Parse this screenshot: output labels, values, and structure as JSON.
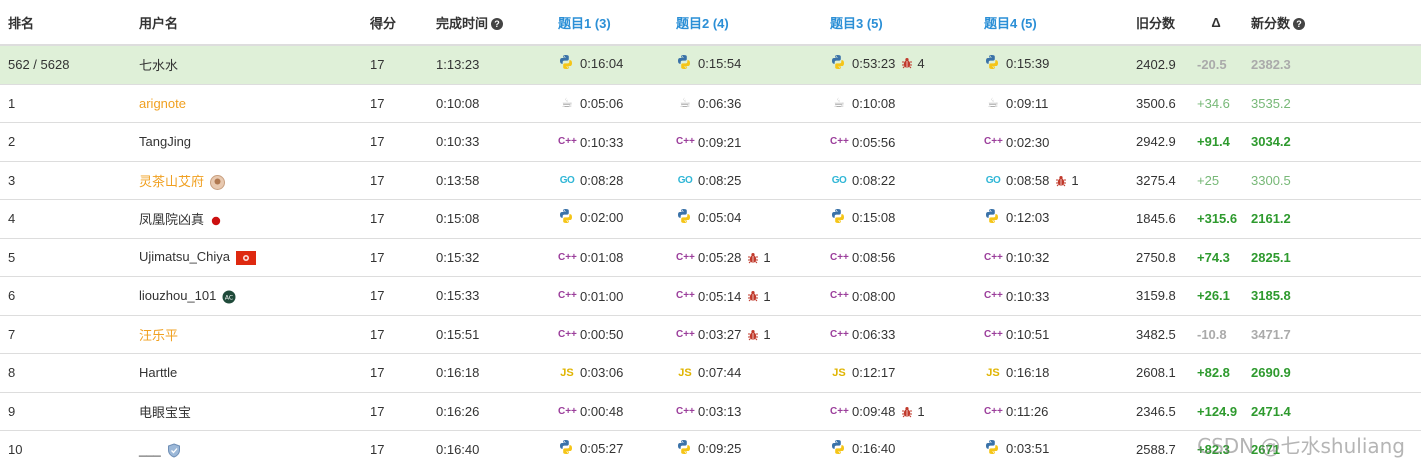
{
  "headers": {
    "rank": "排名",
    "user": "用户名",
    "score": "得分",
    "finish_time": "完成时间",
    "q1": "题目1 (3)",
    "q2": "题目2 (4)",
    "q3": "题目3 (5)",
    "q4": "题目4 (5)",
    "old_rating": "旧分数",
    "delta": "Δ",
    "new_rating": "新分数"
  },
  "rows": [
    {
      "rank": "562 / 5628",
      "user": "七水水",
      "user_style": "normal",
      "badge": "",
      "score": "17",
      "time": "1:13:23",
      "q": [
        {
          "lang": "python",
          "time": "0:16:04",
          "bugs": ""
        },
        {
          "lang": "python",
          "time": "0:15:54",
          "bugs": ""
        },
        {
          "lang": "python",
          "time": "0:53:23",
          "bugs": "4"
        },
        {
          "lang": "python",
          "time": "0:15:39",
          "bugs": ""
        }
      ],
      "old": "2402.9",
      "delta": "-20.5",
      "new": "2382.3",
      "sign": "neg",
      "self": true
    },
    {
      "rank": "1",
      "user": "arignote",
      "user_style": "orange",
      "badge": "",
      "score": "17",
      "time": "0:10:08",
      "q": [
        {
          "lang": "java",
          "time": "0:05:06",
          "bugs": ""
        },
        {
          "lang": "java",
          "time": "0:06:36",
          "bugs": ""
        },
        {
          "lang": "java",
          "time": "0:10:08",
          "bugs": ""
        },
        {
          "lang": "java",
          "time": "0:09:11",
          "bugs": ""
        }
      ],
      "old": "3500.6",
      "delta": "+34.6",
      "new": "3535.2",
      "sign": "light",
      "self": false
    },
    {
      "rank": "2",
      "user": "TangJing",
      "user_style": "normal",
      "badge": "",
      "score": "17",
      "time": "0:10:33",
      "q": [
        {
          "lang": "cpp",
          "time": "0:10:33",
          "bugs": ""
        },
        {
          "lang": "cpp",
          "time": "0:09:21",
          "bugs": ""
        },
        {
          "lang": "cpp",
          "time": "0:05:56",
          "bugs": ""
        },
        {
          "lang": "cpp",
          "time": "0:02:30",
          "bugs": ""
        }
      ],
      "old": "2942.9",
      "delta": "+91.4",
      "new": "3034.2",
      "sign": "pos",
      "self": false
    },
    {
      "rank": "3",
      "user": "灵茶山艾府",
      "user_style": "orange",
      "badge": "avatar",
      "score": "17",
      "time": "0:13:58",
      "q": [
        {
          "lang": "go",
          "time": "0:08:28",
          "bugs": ""
        },
        {
          "lang": "go",
          "time": "0:08:25",
          "bugs": ""
        },
        {
          "lang": "go",
          "time": "0:08:22",
          "bugs": ""
        },
        {
          "lang": "go",
          "time": "0:08:58",
          "bugs": "1"
        }
      ],
      "old": "3275.4",
      "delta": "+25",
      "new": "3300.5",
      "sign": "light",
      "self": false
    },
    {
      "rank": "4",
      "user": "凤凰院凶真",
      "user_style": "normal",
      "badge": "jp-flag",
      "score": "17",
      "time": "0:15:08",
      "q": [
        {
          "lang": "python",
          "time": "0:02:00",
          "bugs": ""
        },
        {
          "lang": "python",
          "time": "0:05:04",
          "bugs": ""
        },
        {
          "lang": "python",
          "time": "0:15:08",
          "bugs": ""
        },
        {
          "lang": "python",
          "time": "0:12:03",
          "bugs": ""
        }
      ],
      "old": "1845.6",
      "delta": "+315.6",
      "new": "2161.2",
      "sign": "pos",
      "self": false
    },
    {
      "rank": "5",
      "user": "Ujimatsu_Chiya",
      "user_style": "normal",
      "badge": "hk-flag",
      "score": "17",
      "time": "0:15:32",
      "q": [
        {
          "lang": "cpp",
          "time": "0:01:08",
          "bugs": ""
        },
        {
          "lang": "cpp",
          "time": "0:05:28",
          "bugs": "1"
        },
        {
          "lang": "cpp",
          "time": "0:08:56",
          "bugs": ""
        },
        {
          "lang": "cpp",
          "time": "0:10:32",
          "bugs": ""
        }
      ],
      "old": "2750.8",
      "delta": "+74.3",
      "new": "2825.1",
      "sign": "pos",
      "self": false
    },
    {
      "rank": "6",
      "user": "liouzhou_101",
      "user_style": "normal",
      "badge": "lc-badge",
      "score": "17",
      "time": "0:15:33",
      "q": [
        {
          "lang": "cpp",
          "time": "0:01:00",
          "bugs": ""
        },
        {
          "lang": "cpp",
          "time": "0:05:14",
          "bugs": "1"
        },
        {
          "lang": "cpp",
          "time": "0:08:00",
          "bugs": ""
        },
        {
          "lang": "cpp",
          "time": "0:10:33",
          "bugs": ""
        }
      ],
      "old": "3159.8",
      "delta": "+26.1",
      "new": "3185.8",
      "sign": "pos",
      "self": false
    },
    {
      "rank": "7",
      "user": "汪乐平",
      "user_style": "orange",
      "badge": "",
      "score": "17",
      "time": "0:15:51",
      "q": [
        {
          "lang": "cpp",
          "time": "0:00:50",
          "bugs": ""
        },
        {
          "lang": "cpp",
          "time": "0:03:27",
          "bugs": "1"
        },
        {
          "lang": "cpp",
          "time": "0:06:33",
          "bugs": ""
        },
        {
          "lang": "cpp",
          "time": "0:10:51",
          "bugs": ""
        }
      ],
      "old": "3482.5",
      "delta": "-10.8",
      "new": "3471.7",
      "sign": "neg",
      "self": false
    },
    {
      "rank": "8",
      "user": "Harttle",
      "user_style": "normal",
      "badge": "",
      "score": "17",
      "time": "0:16:18",
      "q": [
        {
          "lang": "js",
          "time": "0:03:06",
          "bugs": ""
        },
        {
          "lang": "js",
          "time": "0:07:44",
          "bugs": ""
        },
        {
          "lang": "js",
          "time": "0:12:17",
          "bugs": ""
        },
        {
          "lang": "js",
          "time": "0:16:18",
          "bugs": ""
        }
      ],
      "old": "2608.1",
      "delta": "+82.8",
      "new": "2690.9",
      "sign": "pos",
      "self": false
    },
    {
      "rank": "9",
      "user": "电眼宝宝",
      "user_style": "normal",
      "badge": "",
      "score": "17",
      "time": "0:16:26",
      "q": [
        {
          "lang": "cpp",
          "time": "0:00:48",
          "bugs": ""
        },
        {
          "lang": "cpp",
          "time": "0:03:13",
          "bugs": ""
        },
        {
          "lang": "cpp",
          "time": "0:09:48",
          "bugs": "1"
        },
        {
          "lang": "cpp",
          "time": "0:11:26",
          "bugs": ""
        }
      ],
      "old": "2346.5",
      "delta": "+124.9",
      "new": "2471.4",
      "sign": "pos",
      "self": false
    },
    {
      "rank": "10",
      "user": "___",
      "user_style": "normal",
      "badge": "shield",
      "score": "17",
      "time": "0:16:40",
      "q": [
        {
          "lang": "python",
          "time": "0:05:27",
          "bugs": ""
        },
        {
          "lang": "python",
          "time": "0:09:25",
          "bugs": ""
        },
        {
          "lang": "python",
          "time": "0:16:40",
          "bugs": ""
        },
        {
          "lang": "python",
          "time": "0:03:51",
          "bugs": ""
        }
      ],
      "old": "2588.7",
      "delta": "+82.3",
      "new": "2671",
      "sign": "pos",
      "self": false
    }
  ],
  "lang_labels": {
    "cpp": "C++",
    "go": "GO",
    "js": "JS",
    "java": "☕"
  },
  "watermark": "CSDN @七水shuliang",
  "colors": {
    "accent": "#2b8fd6",
    "self_row": "#dff0d8",
    "positive": "#2e9a2e",
    "negative": "#aaaaaa",
    "orange_user": "#f0a020"
  }
}
